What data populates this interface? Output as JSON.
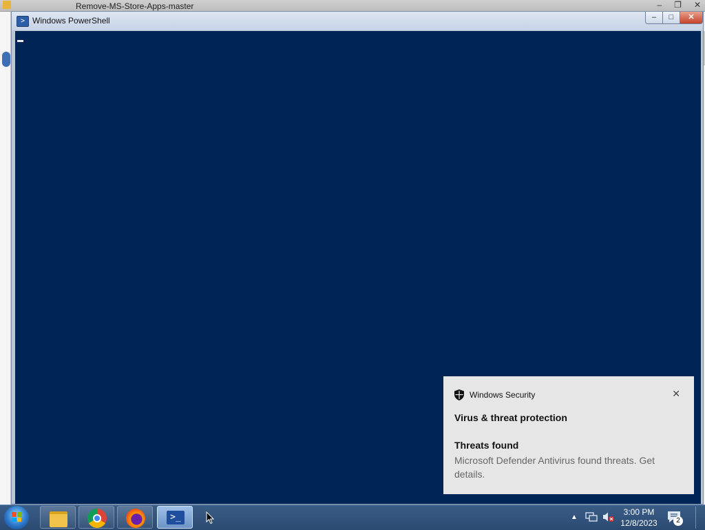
{
  "background_window": {
    "title": "Remove-MS-Store-Apps-master",
    "controls": [
      "–",
      "❐",
      "✕"
    ]
  },
  "powershell": {
    "title": "Windows PowerShell",
    "icon": "powershell-icon",
    "controls": {
      "minimize": "–",
      "maximize": "□",
      "close": "✕"
    },
    "console_bg": "#012456"
  },
  "toast": {
    "app_name": "Windows Security",
    "close_glyph": "✕",
    "heading": "Virus & threat protection",
    "title": "Threats found",
    "body": "Microsoft Defender Antivirus found threats. Get details."
  },
  "taskbar": {
    "pinned": [
      {
        "name": "file-explorer",
        "icon": "folder-icon"
      },
      {
        "name": "google-chrome",
        "icon": "chrome-icon"
      },
      {
        "name": "firefox",
        "icon": "firefox-icon"
      },
      {
        "name": "windows-powershell",
        "icon": "powershell-icon",
        "active": true
      }
    ],
    "tray": {
      "overflow_glyph": "▲",
      "clock_time": "3:00 PM",
      "clock_date": "12/8/2023",
      "notification_count": "2"
    }
  },
  "colors": {
    "console": "#012456",
    "taskbar": "#2f5079",
    "toast_bg": "#e6e6e6"
  }
}
